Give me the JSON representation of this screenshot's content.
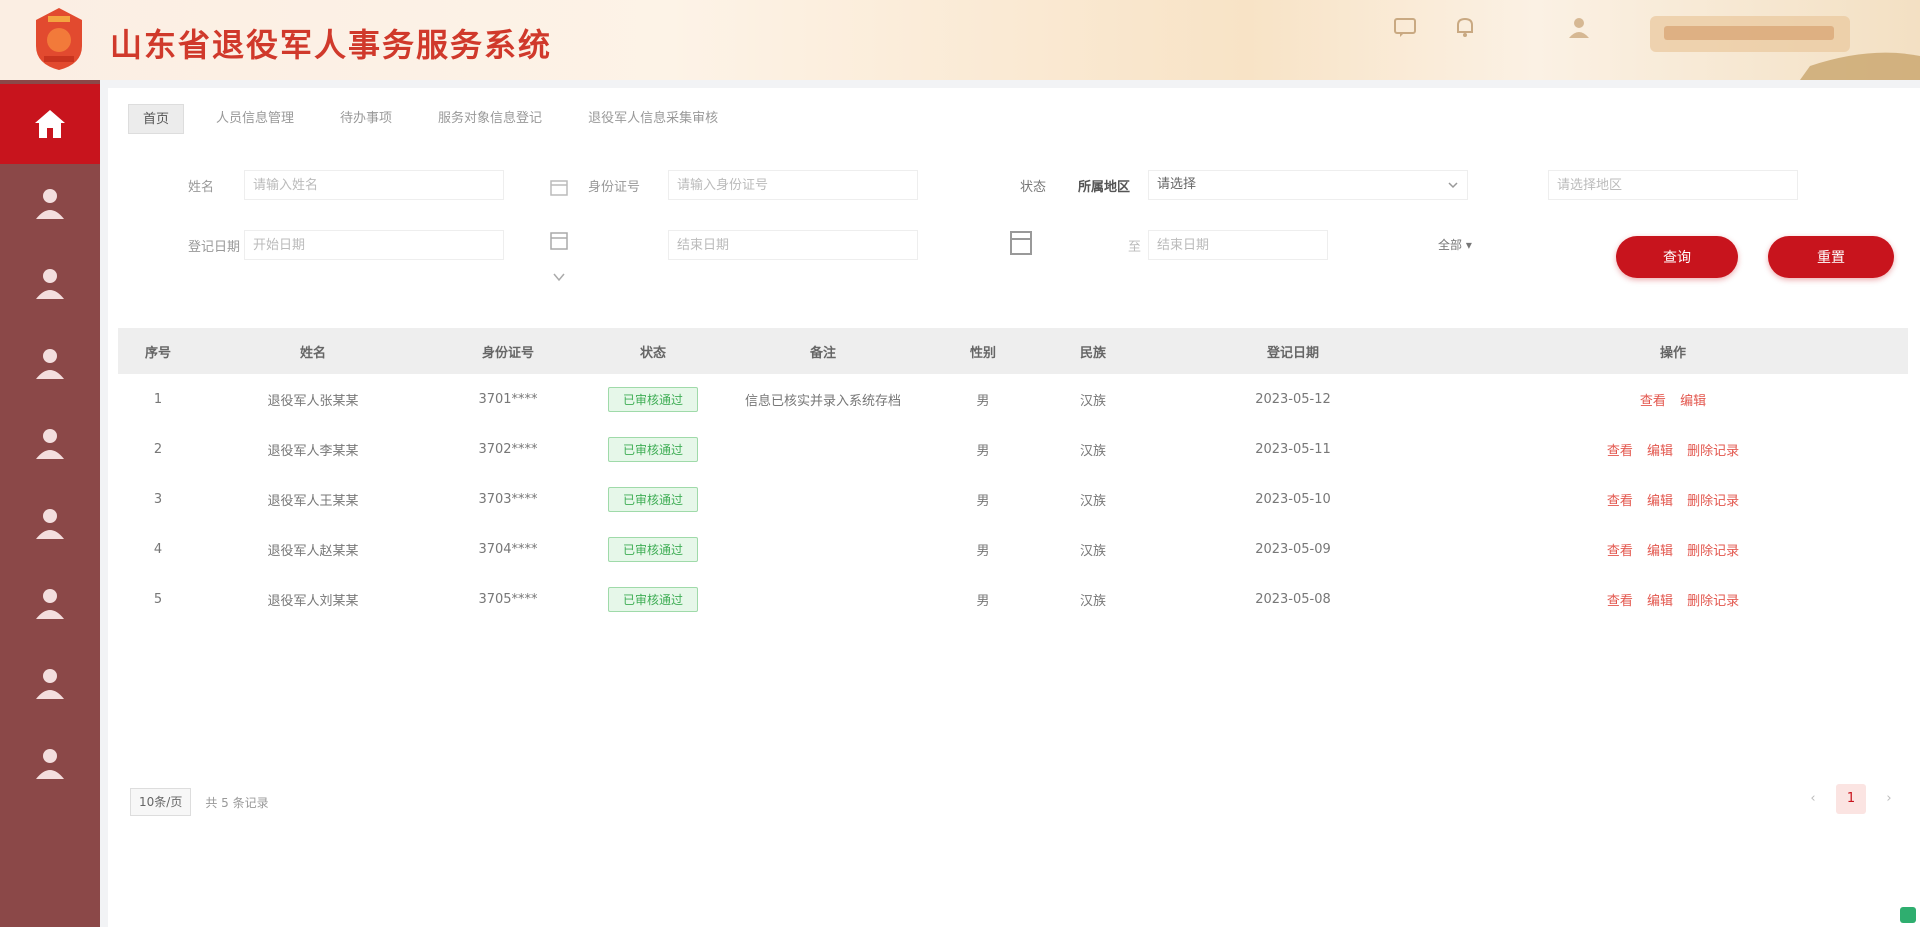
{
  "header": {
    "title": "山东省退役军人事务服务系统",
    "colors": {
      "brand": "#c8141d",
      "sidebar": "#8b4848"
    }
  },
  "sidebar": {
    "items": [
      {
        "icon": "home-icon",
        "active": true
      },
      {
        "icon": "person-icon"
      },
      {
        "icon": "person-icon"
      },
      {
        "icon": "person-icon"
      },
      {
        "icon": "person-icon"
      },
      {
        "icon": "person-icon"
      },
      {
        "icon": "person-icon"
      },
      {
        "icon": "person-icon"
      },
      {
        "icon": "person-icon"
      }
    ]
  },
  "tabs": [
    {
      "label": "首页",
      "active": true
    },
    {
      "label": "人员信息管理"
    },
    {
      "label": "待办事项"
    },
    {
      "label": "服务对象信息登记"
    },
    {
      "label": "退役军人信息采集审核"
    }
  ],
  "filters": {
    "name_label": "姓名",
    "name_placeholder": "请输入姓名",
    "id_label": "身份证号",
    "id_placeholder": "请输入身份证号",
    "status_label": "状态",
    "status_value": "请选择",
    "region_label": "所属地区",
    "region_placeholder": "请选择地区",
    "date_label": "登记日期",
    "date_start_placeholder": "开始日期",
    "date_end_placeholder": "结束日期",
    "to_text": "至",
    "type_value": "全部",
    "search_button": "查询",
    "reset_button": "重置"
  },
  "table": {
    "columns": [
      "序号",
      "姓名",
      "身份证号",
      "状态",
      "备注",
      "性别",
      "民族",
      "登记日期",
      "操作"
    ],
    "rows": [
      {
        "index": "1",
        "name": "退役军人张某某",
        "id": "3701****",
        "status": "已审核通过",
        "remark": "信息已核实并录入系统存档",
        "gender": "男",
        "ethnicity": "汉族",
        "date": "2023-05-12",
        "ops": [
          "查看",
          "编辑"
        ]
      },
      {
        "index": "2",
        "name": "退役军人李某某",
        "id": "3702****",
        "status": "已审核通过",
        "remark": "",
        "gender": "男",
        "ethnicity": "汉族",
        "date": "2023-05-11",
        "ops": [
          "查看",
          "编辑",
          "删除记录"
        ]
      },
      {
        "index": "3",
        "name": "退役军人王某某",
        "id": "3703****",
        "status": "已审核通过",
        "remark": "",
        "gender": "男",
        "ethnicity": "汉族",
        "date": "2023-05-10",
        "ops": [
          "查看",
          "编辑",
          "删除记录"
        ]
      },
      {
        "index": "4",
        "name": "退役军人赵某某",
        "id": "3704****",
        "status": "已审核通过",
        "remark": "",
        "gender": "男",
        "ethnicity": "汉族",
        "date": "2023-05-09",
        "ops": [
          "查看",
          "编辑",
          "删除记录"
        ]
      },
      {
        "index": "5",
        "name": "退役军人刘某某",
        "id": "3705****",
        "status": "已审核通过",
        "remark": "",
        "gender": "男",
        "ethnicity": "汉族",
        "date": "2023-05-08",
        "ops": [
          "查看",
          "编辑",
          "删除记录"
        ]
      }
    ]
  },
  "pagination": {
    "page_size": "10条/页",
    "total_text": "共 5 条记录",
    "prev": "‹",
    "current": "1",
    "next": "›"
  }
}
